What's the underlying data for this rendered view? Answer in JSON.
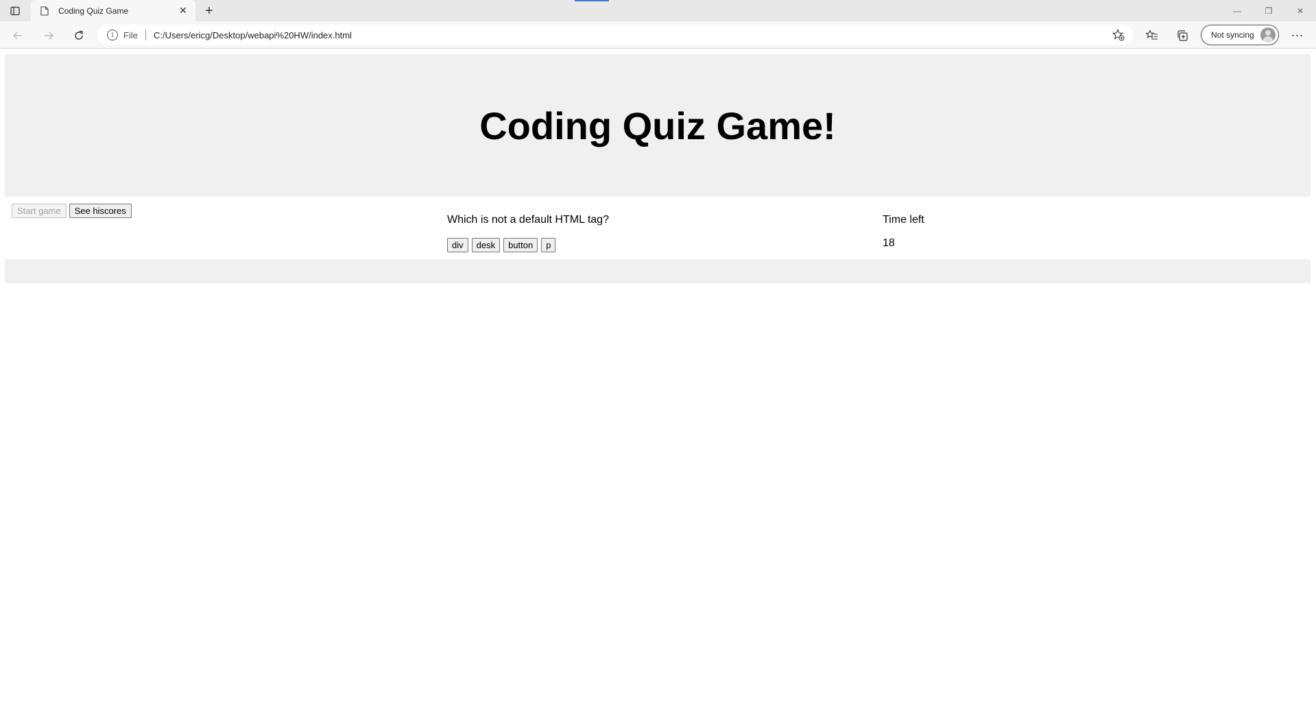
{
  "browser": {
    "tab_title": "Coding Quiz Game",
    "tab_close": "✕",
    "new_tab": "+",
    "address": {
      "scheme_label": "File",
      "url": "C:/Users/ericg/Desktop/webapi%20HW/index.html"
    },
    "profile_label": "Not syncing",
    "window": {
      "minimize": "—",
      "restore": "❐",
      "close": "✕"
    },
    "more": "⋯"
  },
  "page": {
    "heading": "Coding Quiz Game!",
    "controls": {
      "start_label": "Start game",
      "hiscores_label": "See hiscores"
    },
    "quiz": {
      "question": "Which is not a default HTML tag?",
      "answers": [
        "div",
        "desk",
        "button",
        "p"
      ]
    },
    "timer": {
      "label": "Time left",
      "value": "18"
    }
  }
}
